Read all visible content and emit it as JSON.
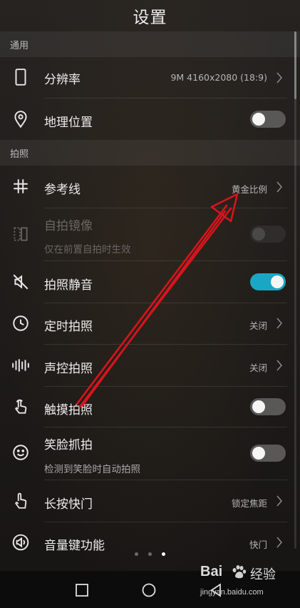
{
  "header": {
    "title": "设置"
  },
  "sections": {
    "general": "通用",
    "photo": "拍照"
  },
  "rows": {
    "resolution": {
      "label": "分辨率",
      "value": "9M 4160x2080 (18:9)",
      "icon": "phone-portrait-icon"
    },
    "location": {
      "label": "地理位置",
      "toggle": false,
      "icon": "location-pin-icon"
    },
    "gridline": {
      "label": "参考线",
      "value": "黄金比例",
      "icon": "grid-hash-icon"
    },
    "selfie_mirror": {
      "label": "自拍镜像",
      "sublabel": "仅在前置自拍时生效",
      "toggle": false,
      "disabled": true,
      "icon": "mirror-icon"
    },
    "mute": {
      "label": "拍照静音",
      "toggle": true,
      "icon": "speaker-mute-icon"
    },
    "timer": {
      "label": "定时拍照",
      "value": "关闭",
      "icon": "clock-icon"
    },
    "voice": {
      "label": "声控拍照",
      "value": "关闭",
      "icon": "sound-wave-icon"
    },
    "touch": {
      "label": "触摸拍照",
      "toggle": false,
      "icon": "touch-finger-icon"
    },
    "smile": {
      "label": "笑脸抓拍",
      "sublabel": "检测到笑脸时自动拍照",
      "toggle": false,
      "icon": "smile-face-icon"
    },
    "long_press": {
      "label": "长按快门",
      "value": "锁定焦距",
      "icon": "hand-press-icon"
    },
    "volume_key": {
      "label": "音量键功能",
      "value": "快门",
      "icon": "volume-key-icon"
    }
  },
  "page_indicator": {
    "count": 3,
    "active": 3
  },
  "nav": [
    "recent-apps-icon",
    "home-icon",
    "back-icon"
  ],
  "watermark": {
    "brand": "Bai",
    "brand_suffix": "经验",
    "url": "jingyan.baidu.com"
  },
  "colors": {
    "accent": "#1aa6c5",
    "arrow": "#d8141c"
  }
}
